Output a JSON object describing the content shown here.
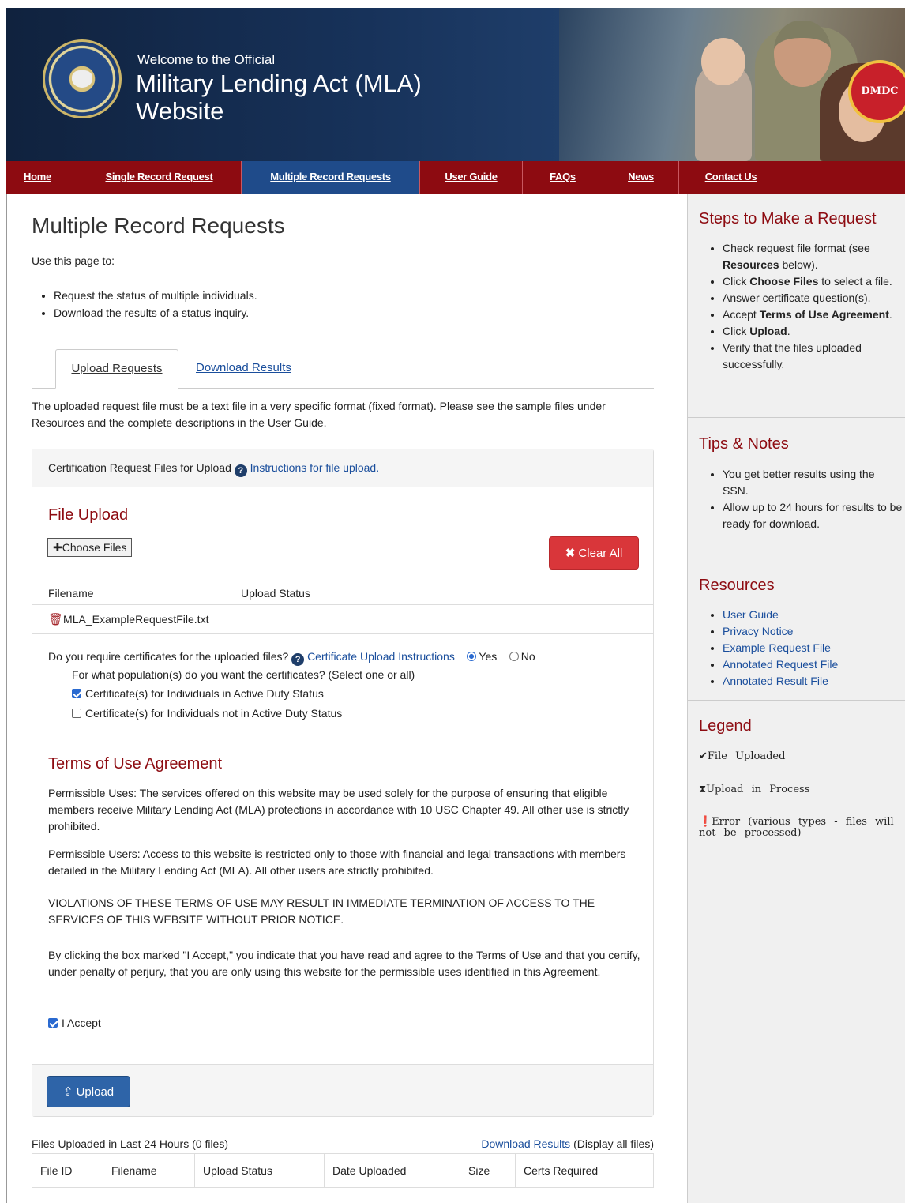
{
  "header": {
    "welcome": "Welcome to the Official",
    "title": "Military Lending Act (MLA) Website",
    "badge": "DMDC"
  },
  "nav": [
    {
      "label": "Home",
      "active": false
    },
    {
      "label": "Single Record Request",
      "active": false
    },
    {
      "label": "Multiple Record Requests",
      "active": true
    },
    {
      "label": "User Guide",
      "active": false
    },
    {
      "label": "FAQs",
      "active": false
    },
    {
      "label": "News",
      "active": false
    },
    {
      "label": "Contact Us",
      "active": false
    }
  ],
  "main": {
    "title": "Multiple Record Requests",
    "intro": "Use this page to:",
    "bullets": [
      "Request the status of multiple individuals.",
      "Download the results of a status inquiry."
    ],
    "tabs": [
      "Upload Requests",
      "Download Results"
    ],
    "description": "The uploaded request file must be a text file in a very specific format (fixed format). Please see the sample files under Resources and the complete descriptions in the User Guide."
  },
  "panel": {
    "heading": "Certification Request Files for Upload",
    "instructions_link": "Instructions for file upload.",
    "file_upload_title": "File Upload",
    "choose_files": "Choose Files",
    "clear_all": "Clear All",
    "col_filename": "Filename",
    "col_status": "Upload Status",
    "file_name": "MLA_ExampleRequestFile.txt",
    "cert_question": "Do you require certificates for the uploaded files?",
    "cert_link": "Certificate Upload Instructions",
    "yes": "Yes",
    "no": "No",
    "population_q": "For what population(s) do you want the certificates? (Select one or all)",
    "active_duty": "Certificate(s) for Individuals in Active Duty Status",
    "not_active_duty": "Certificate(s) for Individuals not in Active Duty Status",
    "terms_title": "Terms of Use Agreement",
    "terms1": "Permissible Uses: The services offered on this website may be used solely for the purpose of ensuring that eligible members receive Military Lending Act (MLA) protections in accordance with 10 USC Chapter 49. All other use is strictly prohibited.",
    "terms2": "Permissible Users: Access to this website is restricted only to those with financial and legal transactions with members detailed in the Military Lending Act (MLA). All other users are strictly prohibited.",
    "terms3": "VIOLATIONS OF THESE TERMS OF USE MAY RESULT IN IMMEDIATE TERMINATION OF ACCESS TO THE SERVICES OF THIS WEBSITE WITHOUT PRIOR NOTICE.",
    "terms4": "By clicking the box marked \"I Accept,\" you indicate that you have read and agree to the Terms of Use and that you certify, under penalty of perjury, that you are only using this website for the permissible uses identified in this Agreement.",
    "accept": "I Accept",
    "upload": "Upload"
  },
  "recent": {
    "label": "Files Uploaded in Last 24 Hours (0 files)",
    "link": "Download Results",
    "link_suffix": "(Display all files)",
    "columns": [
      "File ID",
      "Filename",
      "Upload Status",
      "Date Uploaded",
      "Size",
      "Certs Required"
    ]
  },
  "sidebar": {
    "steps_title": "Steps to Make a Request",
    "tips_title": "Tips & Notes",
    "tips": [
      "You get better results using the SSN.",
      "Allow up to 24 hours for results to be ready for download."
    ],
    "resources_title": "Resources",
    "resources": [
      "User Guide",
      "Privacy Notice",
      "Example Request File",
      "Annotated Request File",
      "Annotated Result File"
    ],
    "legend_title": "Legend",
    "legend": [
      "File Uploaded",
      "Upload in Process",
      "Error (various types - files will not be processed)"
    ]
  }
}
